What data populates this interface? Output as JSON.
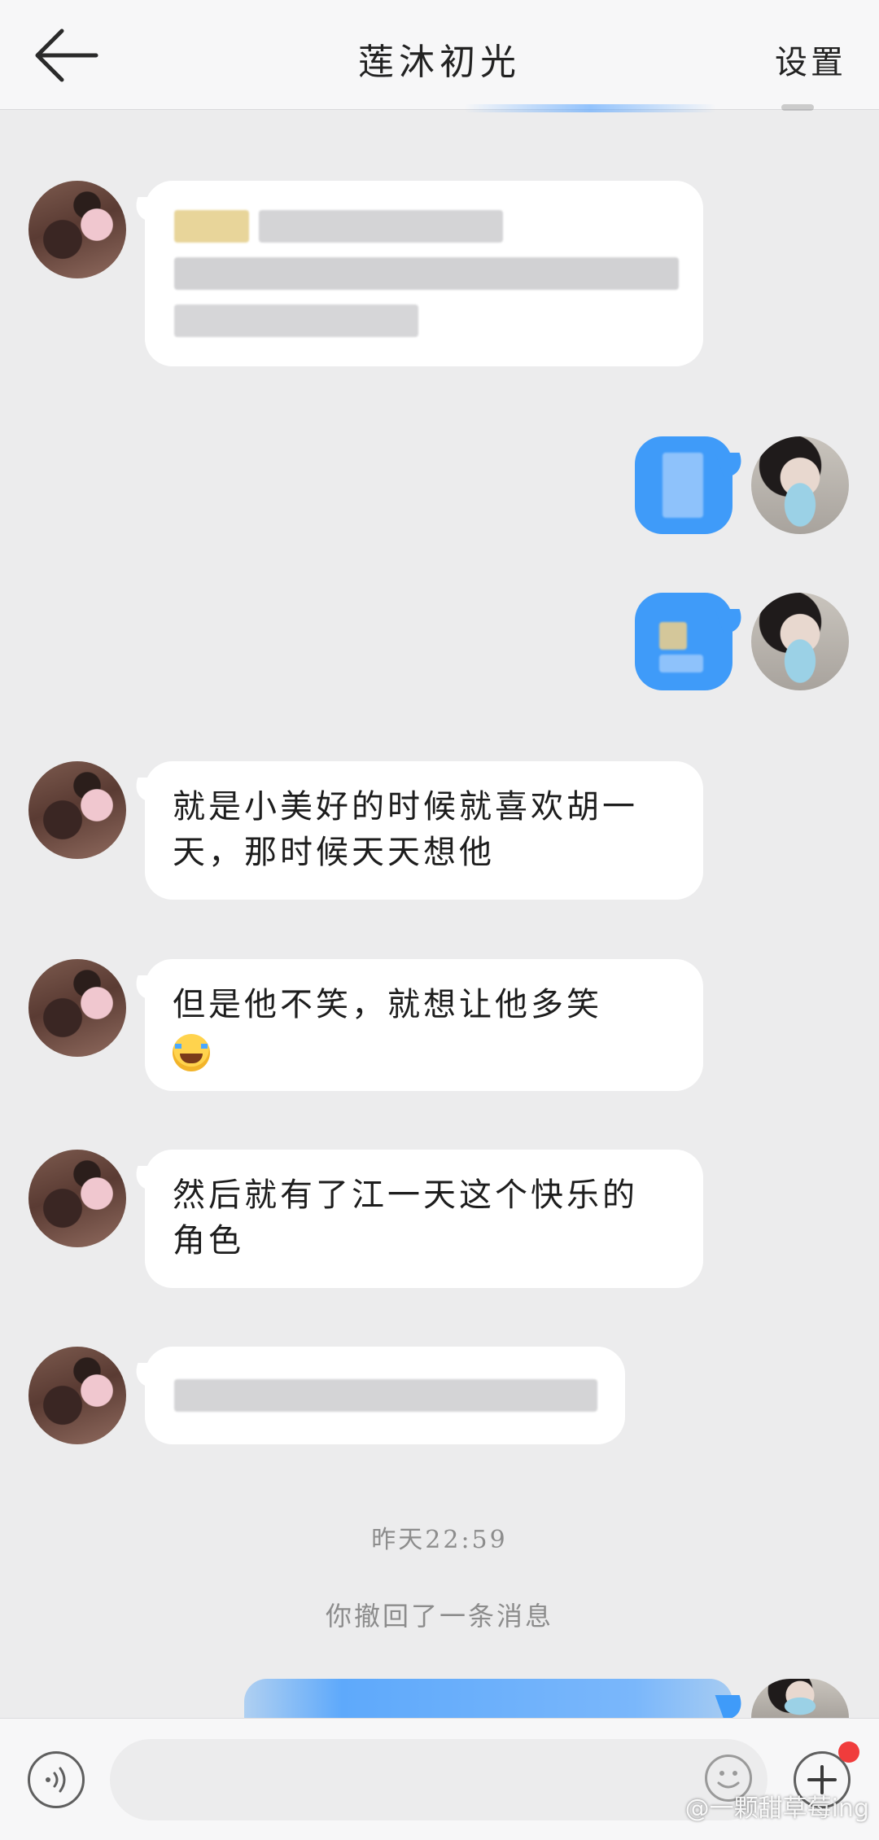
{
  "header": {
    "title": "莲沐初光",
    "settings_label": "设置"
  },
  "messages": [
    {
      "side": "left",
      "text": "",
      "redacted": true
    },
    {
      "side": "right",
      "text": "",
      "redacted": true
    },
    {
      "side": "right",
      "text": "",
      "redacted": true
    },
    {
      "side": "left",
      "lines": [
        "就是小美好的时候就喜欢胡一",
        "天，那时候天天想他"
      ]
    },
    {
      "side": "left",
      "lines": [
        "但是他不笑，就想让他多笑"
      ],
      "trailing_emoji": "tears-of-joy-emoji"
    },
    {
      "side": "left",
      "lines": [
        "然后就有了江一天这个快乐的",
        "角色"
      ]
    },
    {
      "side": "left",
      "text": "",
      "redacted": true
    }
  ],
  "timestamp": "昨天22:59",
  "system_notice": "你撤回了一条消息",
  "input": {
    "placeholder": ""
  },
  "watermark": "@一颗甜草莓ing",
  "colors": {
    "own_bubble": "#3f9bf9",
    "other_bubble": "#ffffff",
    "background": "#ececed",
    "badge": "#f03c3c"
  },
  "icons": [
    "back-arrow-icon",
    "voice-icon",
    "emoji-icon",
    "plus-icon"
  ]
}
